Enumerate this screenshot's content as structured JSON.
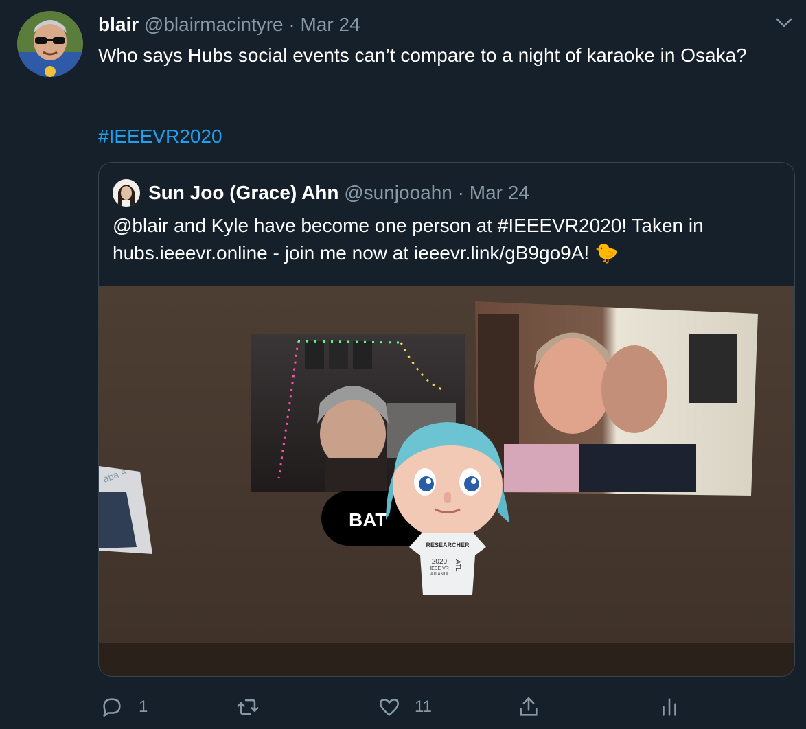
{
  "tweet": {
    "author_name": "blair",
    "author_handle": "@blairmacintyre",
    "separator": "·",
    "date": "Mar 24",
    "text": "Who says Hubs social events can’t compare to a night of karaoke in Osaka?",
    "hashtag": "#IEEEVR2020"
  },
  "quoted_tweet": {
    "author_name": "Sun Joo (Grace) Ahn",
    "author_handle": "@sunjooahn",
    "separator": "·",
    "date": "Mar 24",
    "text": "@blair and Kyle have become one person at #IEEEVR2020!  Taken in hubs.ieeevr.online - join me now at ieeevr.link/gB9go9A! 🐤",
    "media": {
      "name_tag": "BAT",
      "shirt_line1": "RESEARCHER",
      "shirt_line2": "2020",
      "shirt_line3": "IEEE VR",
      "shirt_line4": "ATLANTA",
      "shirt_side": "ATL",
      "side_panel_text": "aba A"
    }
  },
  "actions": {
    "reply_count": "1",
    "like_count": "11"
  },
  "icons": {
    "caret": "chevron-down-icon",
    "reply": "reply-icon",
    "retweet": "retweet-icon",
    "like": "heart-icon",
    "share": "share-icon",
    "analytics": "analytics-icon"
  },
  "colors": {
    "background": "#15202b",
    "link": "#1da1f2",
    "secondary_text": "#8899a6",
    "border": "#38444d"
  }
}
